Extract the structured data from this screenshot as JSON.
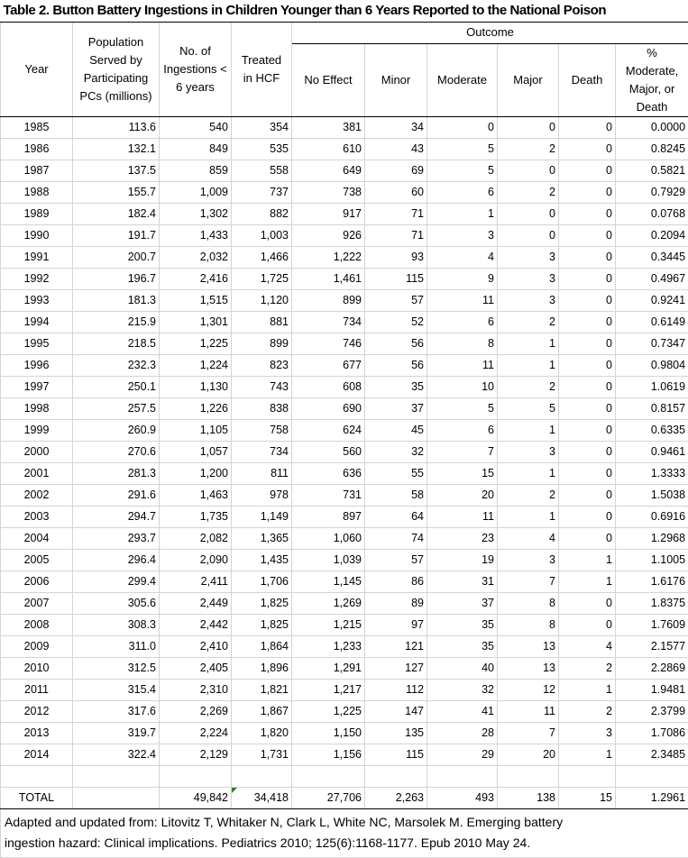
{
  "title": "Table 2. Button Battery Ingestions in Children Younger than 6 Years Reported to the National Poison",
  "headers": {
    "year": [
      "Year"
    ],
    "population": [
      "Population",
      "Served by",
      "Participating",
      "PCs (millions)"
    ],
    "ingestions": [
      "No. of",
      "Ingestions <",
      "6 years"
    ],
    "treated": [
      "Treated",
      "in HCF"
    ],
    "outcome": "Outcome",
    "outcome_columns": [
      [
        "No Effect"
      ],
      [
        "Minor"
      ],
      [
        "Moderate"
      ],
      [
        "Major"
      ],
      [
        "Death"
      ],
      [
        "%",
        "Moderate,",
        "Major, or",
        "Death"
      ]
    ]
  },
  "columns": [
    "year",
    "population",
    "ingestions",
    "treated",
    "no-effect",
    "minor",
    "moderate",
    "major",
    "death",
    "pct-moderate-major-death"
  ],
  "rows": [
    [
      "1985",
      "113.6",
      "540",
      "354",
      "381",
      "34",
      "0",
      "0",
      "0",
      "0.0000"
    ],
    [
      "1986",
      "132.1",
      "849",
      "535",
      "610",
      "43",
      "5",
      "2",
      "0",
      "0.8245"
    ],
    [
      "1987",
      "137.5",
      "859",
      "558",
      "649",
      "69",
      "5",
      "0",
      "0",
      "0.5821"
    ],
    [
      "1988",
      "155.7",
      "1,009",
      "737",
      "738",
      "60",
      "6",
      "2",
      "0",
      "0.7929"
    ],
    [
      "1989",
      "182.4",
      "1,302",
      "882",
      "917",
      "71",
      "1",
      "0",
      "0",
      "0.0768"
    ],
    [
      "1990",
      "191.7",
      "1,433",
      "1,003",
      "926",
      "71",
      "3",
      "0",
      "0",
      "0.2094"
    ],
    [
      "1991",
      "200.7",
      "2,032",
      "1,466",
      "1,222",
      "93",
      "4",
      "3",
      "0",
      "0.3445"
    ],
    [
      "1992",
      "196.7",
      "2,416",
      "1,725",
      "1,461",
      "115",
      "9",
      "3",
      "0",
      "0.4967"
    ],
    [
      "1993",
      "181.3",
      "1,515",
      "1,120",
      "899",
      "57",
      "11",
      "3",
      "0",
      "0.9241"
    ],
    [
      "1994",
      "215.9",
      "1,301",
      "881",
      "734",
      "52",
      "6",
      "2",
      "0",
      "0.6149"
    ],
    [
      "1995",
      "218.5",
      "1,225",
      "899",
      "746",
      "56",
      "8",
      "1",
      "0",
      "0.7347"
    ],
    [
      "1996",
      "232.3",
      "1,224",
      "823",
      "677",
      "56",
      "11",
      "1",
      "0",
      "0.9804"
    ],
    [
      "1997",
      "250.1",
      "1,130",
      "743",
      "608",
      "35",
      "10",
      "2",
      "0",
      "1.0619"
    ],
    [
      "1998",
      "257.5",
      "1,226",
      "838",
      "690",
      "37",
      "5",
      "5",
      "0",
      "0.8157"
    ],
    [
      "1999",
      "260.9",
      "1,105",
      "758",
      "624",
      "45",
      "6",
      "1",
      "0",
      "0.6335"
    ],
    [
      "2000",
      "270.6",
      "1,057",
      "734",
      "560",
      "32",
      "7",
      "3",
      "0",
      "0.9461"
    ],
    [
      "2001",
      "281.3",
      "1,200",
      "811",
      "636",
      "55",
      "15",
      "1",
      "0",
      "1.3333"
    ],
    [
      "2002",
      "291.6",
      "1,463",
      "978",
      "731",
      "58",
      "20",
      "2",
      "0",
      "1.5038"
    ],
    [
      "2003",
      "294.7",
      "1,735",
      "1,149",
      "897",
      "64",
      "11",
      "1",
      "0",
      "0.6916"
    ],
    [
      "2004",
      "293.7",
      "2,082",
      "1,365",
      "1,060",
      "74",
      "23",
      "4",
      "0",
      "1.2968"
    ],
    [
      "2005",
      "296.4",
      "2,090",
      "1,435",
      "1,039",
      "57",
      "19",
      "3",
      "1",
      "1.1005"
    ],
    [
      "2006",
      "299.4",
      "2,411",
      "1,706",
      "1,145",
      "86",
      "31",
      "7",
      "1",
      "1.6176"
    ],
    [
      "2007",
      "305.6",
      "2,449",
      "1,825",
      "1,269",
      "89",
      "37",
      "8",
      "0",
      "1.8375"
    ],
    [
      "2008",
      "308.3",
      "2,442",
      "1,825",
      "1,215",
      "97",
      "35",
      "8",
      "0",
      "1.7609"
    ],
    [
      "2009",
      "311.0",
      "2,410",
      "1,864",
      "1,233",
      "121",
      "35",
      "13",
      "4",
      "2.1577"
    ],
    [
      "2010",
      "312.5",
      "2,405",
      "1,896",
      "1,291",
      "127",
      "40",
      "13",
      "2",
      "2.2869"
    ],
    [
      "2011",
      "315.4",
      "2,310",
      "1,821",
      "1,217",
      "112",
      "32",
      "12",
      "1",
      "1.9481"
    ],
    [
      "2012",
      "317.6",
      "2,269",
      "1,867",
      "1,225",
      "147",
      "41",
      "11",
      "2",
      "2.3799"
    ],
    [
      "2013",
      "319.7",
      "2,224",
      "1,820",
      "1,150",
      "135",
      "28",
      "7",
      "3",
      "1.7086"
    ],
    [
      "2014",
      "322.4",
      "2,129",
      "1,731",
      "1,156",
      "115",
      "29",
      "20",
      "1",
      "2.3485"
    ]
  ],
  "total": [
    "TOTAL",
    "",
    "49,842",
    "34,418",
    "27,706",
    "2,263",
    "493",
    "138",
    "15",
    "1.2961"
  ],
  "footnote": [
    "Adapted and updated from: Litovitz T, Whitaker N, Clark L, White NC, Marsolek M. Emerging battery",
    "ingestion hazard: Clinical implications.  Pediatrics 2010; 125(6):1168-1177. Epub 2010 May 24."
  ],
  "icons": {
    "total_treated_cell_flag": "error-indicator-triangle"
  },
  "colors": {
    "grid": "#d4d4d4",
    "rule": "#000000",
    "error_indicator": "#1e8a1e"
  }
}
